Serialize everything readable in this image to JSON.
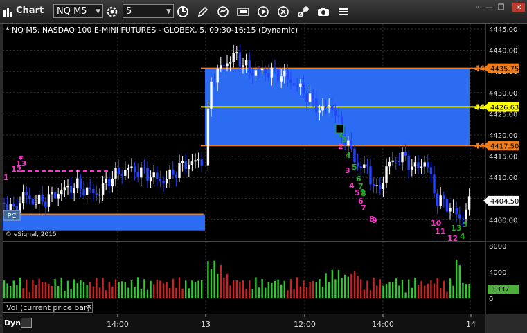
{
  "window": {
    "title": "Chart"
  },
  "toolbar": {
    "symbol": "NQ M5",
    "interval": "5",
    "icons": [
      "settings-icon",
      "clock-icon",
      "pencil-icon",
      "refresh-icon",
      "dollar-chart-icon",
      "play-icon",
      "cancel-icon",
      "link-icon",
      "camera-icon",
      "menu-icon"
    ]
  },
  "chart": {
    "instrument_line": "* NQ M5, NASDAQ 100 E-MINI FUTURES - GLOBEX, 5, 09:30-16:15 (Dynamic)",
    "watermark": "© eSignal, 2015",
    "price_ticks": [
      "4445.00",
      "4440.00",
      "4435.00",
      "4430.00",
      "4425.00",
      "4420.00",
      "4415.00",
      "4410.00",
      "4405.00",
      "4400.00"
    ],
    "level_labels": [
      {
        "text": "4435.75",
        "value": 4435.75,
        "bg": "#f07d1c",
        "fg": "#000000"
      },
      {
        "text": "4426.63",
        "value": 4426.63,
        "bg": "#ffff00",
        "fg": "#000000"
      },
      {
        "text": "4417.50",
        "value": 4417.5,
        "bg": "#f07d1c",
        "fg": "#000000"
      },
      {
        "text": "4404.50",
        "value": 4404.5,
        "bg": "#ffffff",
        "fg": "#000000"
      }
    ],
    "level_prefix": "44",
    "pc_label": "PC",
    "time_labels": [
      "14:00",
      "13",
      "12:00",
      "14:00",
      "14"
    ],
    "volume_ticks": [
      "8000",
      "4000",
      "0"
    ],
    "volume_value": "1337",
    "volume_label": "Vol (current price bar)",
    "dyn_label": "Dyn",
    "td_counts": [
      {
        "t": "1",
        "c": "#ff33cc"
      },
      {
        "t": "12",
        "c": "#ff33cc"
      },
      {
        "t": "13",
        "c": "#ff33cc"
      },
      {
        "t": "1",
        "c": "#ff33cc"
      },
      {
        "t": "2",
        "c": "#ff33cc"
      },
      {
        "t": "3",
        "c": "#ff33cc"
      },
      {
        "t": "4",
        "c": "#ff33cc"
      },
      {
        "t": "5",
        "c": "#ff33cc"
      },
      {
        "t": "6",
        "c": "#ff33cc"
      },
      {
        "t": "7",
        "c": "#ff33cc"
      },
      {
        "t": "8",
        "c": "#ff33cc"
      },
      {
        "t": "9",
        "c": "#ff33cc"
      },
      {
        "t": "10",
        "c": "#ff33cc"
      },
      {
        "t": "11",
        "c": "#ff33cc"
      },
      {
        "t": "12",
        "c": "#ff33cc"
      },
      {
        "t": "1",
        "c": "#22aa22"
      },
      {
        "t": "2",
        "c": "#22aa22"
      },
      {
        "t": "3",
        "c": "#22aa22"
      },
      {
        "t": "4",
        "c": "#22aa22"
      },
      {
        "t": "5",
        "c": "#22aa22"
      },
      {
        "t": "6",
        "c": "#22aa22"
      },
      {
        "t": "7",
        "c": "#22aa22"
      },
      {
        "t": "8",
        "c": "#22aa22"
      },
      {
        "t": "9",
        "c": "#22aa22"
      },
      {
        "t": "1",
        "c": "#22aa22"
      },
      {
        "t": "3",
        "c": "#22aa22"
      },
      {
        "t": "4",
        "c": "#22aa22"
      },
      {
        "t": "5",
        "c": "#22aa22"
      }
    ],
    "colors": {
      "range_band": "#2b6cf2",
      "orange": "#f07d1c",
      "yellow": "#ffff00",
      "magenta": "#ff33cc",
      "up": "#ffffff",
      "down": "#2244ff",
      "vol_up": "#2ecc2e",
      "vol_down": "#cc2222"
    }
  }
}
